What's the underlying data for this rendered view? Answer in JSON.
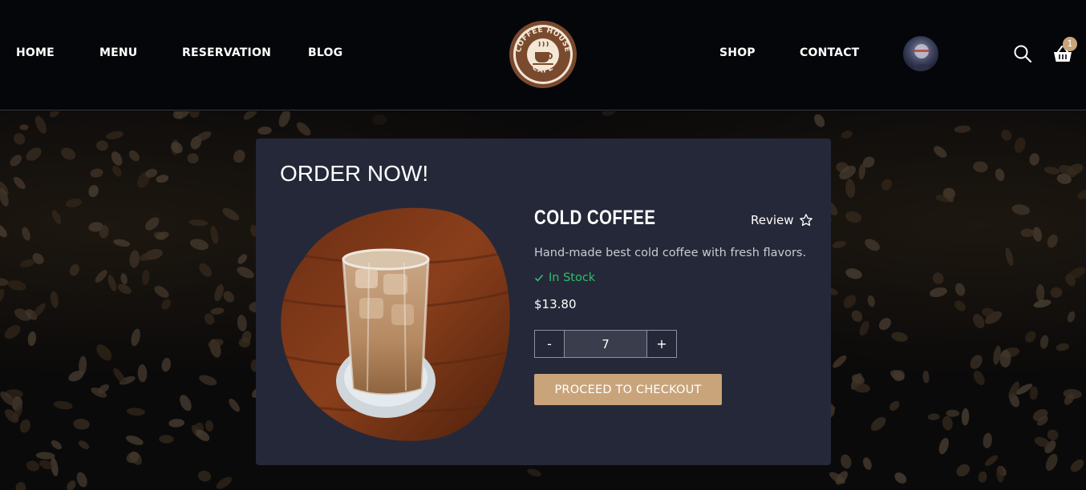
{
  "nav": {
    "home": "HOME",
    "menu": "MENU",
    "reservation": "RESERVATION",
    "blog": "BLOG",
    "shop": "SHOP",
    "contact": "CONTACT"
  },
  "logo": {
    "top_text": "COFFEE HOUSE",
    "bottom_text": "CAFE",
    "icon": "coffee-cup-icon"
  },
  "header_icons": {
    "avatar": "user-avatar",
    "search": "search-icon",
    "cart": "cart-icon",
    "cart_count": "1"
  },
  "order": {
    "title": "ORDER NOW!",
    "product_name": "COLD COFFEE",
    "review_label": "Review",
    "review_icon": "star-outline-icon",
    "description": "Hand-made best cold coffee with fresh flavors.",
    "stock_status": "In Stock",
    "stock_icon": "check-icon",
    "price": "$13.80",
    "quantity": "7",
    "minus_label": "-",
    "plus_label": "+",
    "checkout_label": "PROCEED TO CHECKOUT"
  },
  "colors": {
    "accent": "#c9a47a",
    "card_bg": "#252838",
    "header_bg": "#05060a",
    "stock_green": "#2ec06a"
  }
}
